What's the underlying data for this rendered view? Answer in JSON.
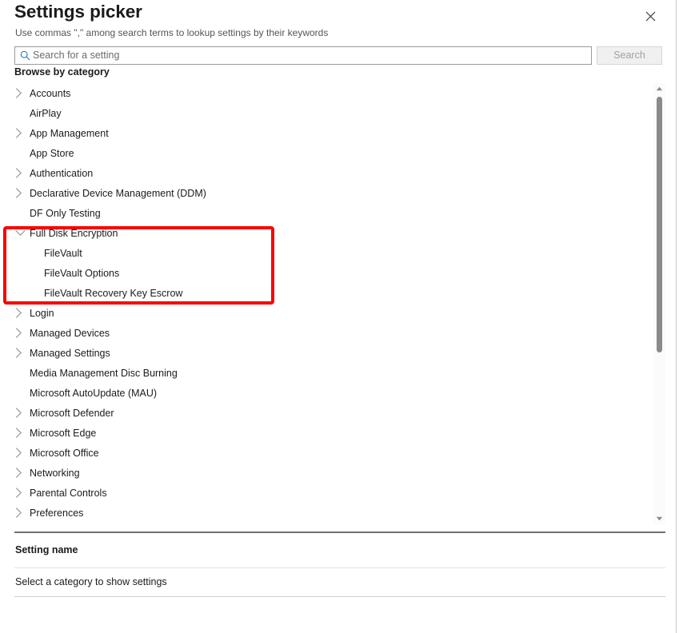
{
  "dialog": {
    "title": "Settings picker",
    "subtitle": "Use commas \",\" among search terms to lookup settings by their keywords",
    "close_icon": "close-icon"
  },
  "search": {
    "placeholder": "Search for a setting",
    "value": "",
    "icon": "search-icon",
    "button_label": "Search",
    "button_enabled": false
  },
  "browse": {
    "label": "Browse by category"
  },
  "categories": [
    {
      "label": "Accounts",
      "expandable": true,
      "expanded": false,
      "child": false
    },
    {
      "label": "AirPlay",
      "expandable": false,
      "expanded": false,
      "child": false
    },
    {
      "label": "App Management",
      "expandable": true,
      "expanded": false,
      "child": false
    },
    {
      "label": "App Store",
      "expandable": false,
      "expanded": false,
      "child": false
    },
    {
      "label": "Authentication",
      "expandable": true,
      "expanded": false,
      "child": false
    },
    {
      "label": "Declarative Device Management (DDM)",
      "expandable": true,
      "expanded": false,
      "child": false
    },
    {
      "label": "DF Only Testing",
      "expandable": false,
      "expanded": false,
      "child": false
    },
    {
      "label": "Full Disk Encryption",
      "expandable": true,
      "expanded": true,
      "child": false
    },
    {
      "label": "FileVault",
      "expandable": false,
      "expanded": false,
      "child": true
    },
    {
      "label": "FileVault Options",
      "expandable": false,
      "expanded": false,
      "child": true
    },
    {
      "label": "FileVault Recovery Key Escrow",
      "expandable": false,
      "expanded": false,
      "child": true
    },
    {
      "label": "Login",
      "expandable": true,
      "expanded": false,
      "child": false
    },
    {
      "label": "Managed Devices",
      "expandable": true,
      "expanded": false,
      "child": false
    },
    {
      "label": "Managed Settings",
      "expandable": true,
      "expanded": false,
      "child": false
    },
    {
      "label": "Media Management Disc Burning",
      "expandable": false,
      "expanded": false,
      "child": false
    },
    {
      "label": "Microsoft AutoUpdate (MAU)",
      "expandable": false,
      "expanded": false,
      "child": false
    },
    {
      "label": "Microsoft Defender",
      "expandable": true,
      "expanded": false,
      "child": false
    },
    {
      "label": "Microsoft Edge",
      "expandable": true,
      "expanded": false,
      "child": false
    },
    {
      "label": "Microsoft Office",
      "expandable": true,
      "expanded": false,
      "child": false
    },
    {
      "label": "Networking",
      "expandable": true,
      "expanded": false,
      "child": false
    },
    {
      "label": "Parental Controls",
      "expandable": true,
      "expanded": false,
      "child": false
    },
    {
      "label": "Preferences",
      "expandable": true,
      "expanded": false,
      "child": false
    }
  ],
  "scrollbar": {
    "up_icon": "scroll-up-arrow-icon",
    "down_icon": "scroll-down-arrow-icon"
  },
  "settings_panel": {
    "column_header": "Setting name",
    "empty_message": "Select a category to show settings"
  },
  "annotation": {
    "color": "#fc0000",
    "highlights": [
      "Full Disk Encryption",
      "FileVault",
      "FileVault Options",
      "FileVault Recovery Key Escrow"
    ]
  }
}
